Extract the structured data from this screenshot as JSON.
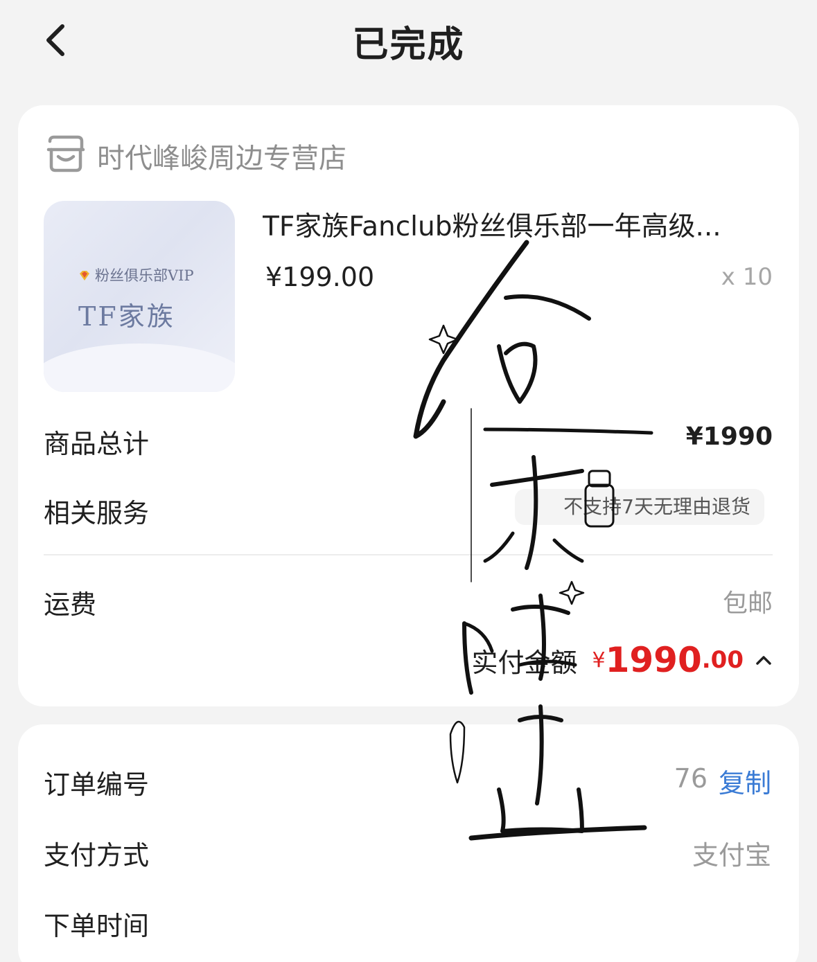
{
  "header": {
    "title": "已完成"
  },
  "store": {
    "name": "时代峰峻周边专营店",
    "icon": "store-icon"
  },
  "product": {
    "image_text_vip": "粉丝俱乐部VIP",
    "image_text_brand": "TF家族",
    "title": "TF家族Fanclub粉丝俱乐部一年高级...",
    "price": "¥199.00",
    "quantity": "x 10"
  },
  "summary": {
    "total_label": "商品总计",
    "total_value": "¥1990",
    "service_label": "相关服务",
    "service_value": "不支持7天无理由退货",
    "shipping_label": "运费",
    "shipping_value": "包邮",
    "paid_label": "实付金额",
    "paid_currency": "¥",
    "paid_integer": "1990",
    "paid_decimal": ".00"
  },
  "order_info": {
    "order_no_label": "订单编号",
    "order_no_value": "76",
    "copy_label": "复制",
    "payment_label": "支付方式",
    "payment_value": "支付宝",
    "time_label": "下单时间"
  },
  "colors": {
    "accent_red": "#e02020",
    "link_blue": "#3a7bd5",
    "background": "#f3f3f3"
  }
}
